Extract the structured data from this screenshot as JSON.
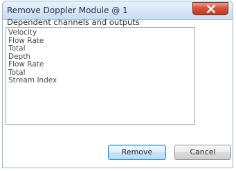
{
  "dialog": {
    "title": "Remove Doppler Module @ 1",
    "section_label": "Dependent channels and outputs",
    "items": [
      "Velocity",
      "Flow Rate",
      "Total",
      "Depth",
      "Flow Rate",
      "Total",
      "Stream Index"
    ],
    "remove_label": "Remove",
    "cancel_label": "Cancel",
    "close_icon": "close-icon",
    "colors": {
      "close_button": "#c94a2f",
      "default_button_border": "#3f8fd6",
      "titlebar": "#d6e5f5"
    }
  }
}
